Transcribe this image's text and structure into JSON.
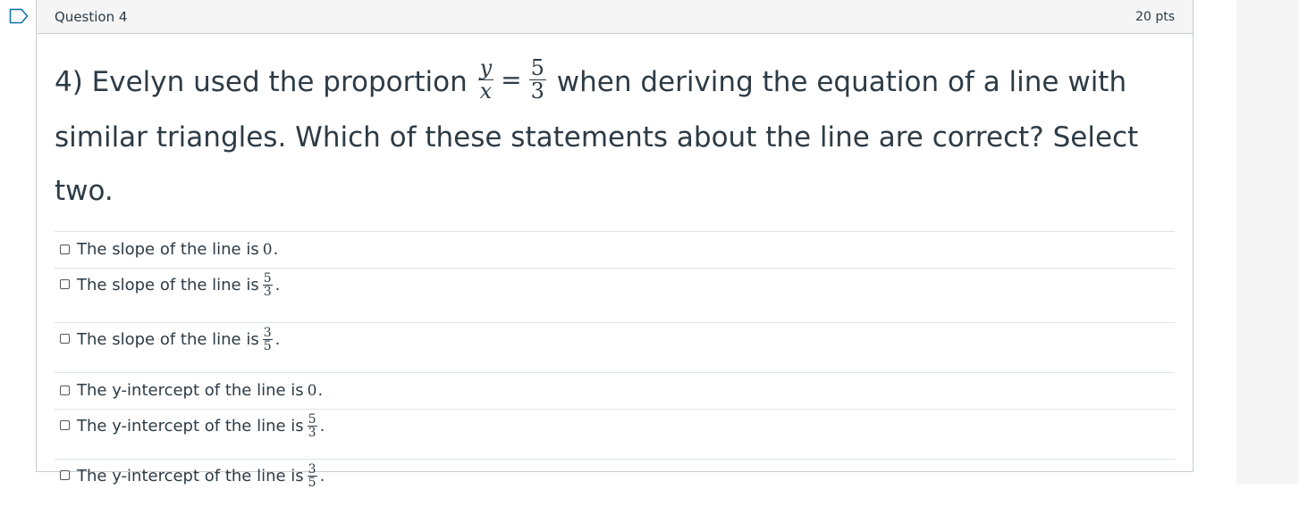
{
  "question": {
    "title": "Question 4",
    "points": "20 pts",
    "text_prefix": "4) Evelyn used the proportion ",
    "text_suffix": " when deriving the equation of a line with similar triangles. Which of these statements about the line are correct? Select two.",
    "proportion": {
      "left_num": "y",
      "left_den": "x",
      "equals": "=",
      "right_num": "5",
      "right_den": "3"
    }
  },
  "answers": [
    {
      "prefix": "The slope of the line is",
      "type": "number",
      "value": "0",
      "suffix": "."
    },
    {
      "prefix": "The slope of the line is",
      "type": "fraction",
      "num": "5",
      "den": "3",
      "suffix": "."
    },
    {
      "prefix": "The slope of the line is",
      "type": "fraction",
      "num": "3",
      "den": "5",
      "suffix": "."
    },
    {
      "prefix": "The y-intercept of the line is",
      "type": "number",
      "value": "0",
      "suffix": "."
    },
    {
      "prefix": "The y-intercept of the line is",
      "type": "fraction",
      "num": "5",
      "den": "3",
      "suffix": "."
    },
    {
      "prefix": "The y-intercept of the line is",
      "type": "fraction",
      "num": "3",
      "den": "5",
      "suffix": "."
    }
  ],
  "colors": {
    "text": "#2d3b45",
    "header_bg": "#f5f5f5",
    "border": "#c7cdd1",
    "flag": "#0770a3"
  },
  "icons": {
    "flag": "flag-question-icon"
  }
}
